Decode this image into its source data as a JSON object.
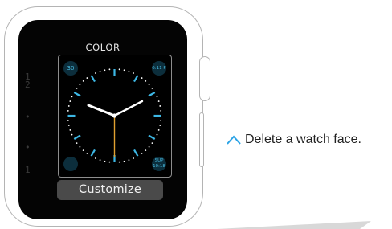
{
  "screen": {
    "mode_label": "COLOR",
    "customize_button": "Customize"
  },
  "watch_face": {
    "complications": {
      "top_left": "30",
      "top_right": "6:11 P",
      "bottom_right": "SUP 10:18"
    },
    "accent_color": "#3db7e4",
    "second_hand_color": "#e0a030"
  },
  "callout": {
    "icon": "chevron-up-icon",
    "text": "Delete a watch face."
  }
}
